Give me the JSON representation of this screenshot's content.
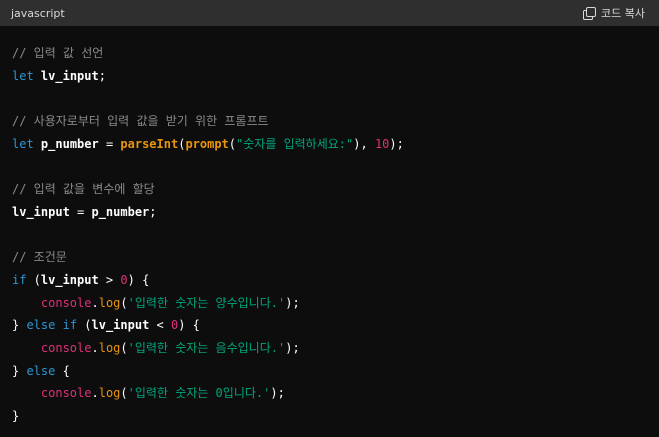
{
  "header": {
    "language": "javascript",
    "copy_label": "코드 복사",
    "copy_icon": "copy-icon"
  },
  "colors": {
    "header_bg": "#2f2f2f",
    "code_bg": "#0d0d0d",
    "comment": "#8a8a8a",
    "keyword": "#2e95d3",
    "string": "#00a67d",
    "number": "#df3079",
    "builtin": "#e9950c"
  },
  "code": {
    "lines": [
      [
        {
          "t": "c",
          "v": "// 입력 값 선언"
        }
      ],
      [
        {
          "t": "k",
          "v": "let"
        },
        {
          "t": "o",
          "v": " "
        },
        {
          "t": "i",
          "v": "lv_input"
        },
        {
          "t": "p",
          "v": ";"
        }
      ],
      [],
      [
        {
          "t": "c",
          "v": "// 사용자로부터 입력 값을 받기 위한 프롬프트"
        }
      ],
      [
        {
          "t": "k",
          "v": "let"
        },
        {
          "t": "o",
          "v": " "
        },
        {
          "t": "i",
          "v": "p_number"
        },
        {
          "t": "o",
          "v": " = "
        },
        {
          "t": "b",
          "v": "parseInt"
        },
        {
          "t": "p",
          "v": "("
        },
        {
          "t": "b",
          "v": "prompt"
        },
        {
          "t": "p",
          "v": "("
        },
        {
          "t": "s",
          "v": "\"숫자를 입력하세요:\""
        },
        {
          "t": "p",
          "v": "), "
        },
        {
          "t": "n",
          "v": "10"
        },
        {
          "t": "p",
          "v": ");"
        }
      ],
      [],
      [
        {
          "t": "c",
          "v": "// 입력 값을 변수에 할당"
        }
      ],
      [
        {
          "t": "i",
          "v": "lv_input"
        },
        {
          "t": "o",
          "v": " = "
        },
        {
          "t": "i",
          "v": "p_number"
        },
        {
          "t": "p",
          "v": ";"
        }
      ],
      [],
      [
        {
          "t": "c",
          "v": "// 조건문"
        }
      ],
      [
        {
          "t": "k",
          "v": "if"
        },
        {
          "t": "p",
          "v": " ("
        },
        {
          "t": "i",
          "v": "lv_input"
        },
        {
          "t": "o",
          "v": " > "
        },
        {
          "t": "n",
          "v": "0"
        },
        {
          "t": "p",
          "v": ") {"
        }
      ],
      [
        {
          "t": "o",
          "v": "    "
        },
        {
          "t": "cn",
          "v": "console"
        },
        {
          "t": "p",
          "v": "."
        },
        {
          "t": "m",
          "v": "log"
        },
        {
          "t": "p",
          "v": "("
        },
        {
          "t": "s",
          "v": "'입력한 숫자는 양수입니다.'"
        },
        {
          "t": "p",
          "v": ");"
        }
      ],
      [
        {
          "t": "p",
          "v": "} "
        },
        {
          "t": "k",
          "v": "else"
        },
        {
          "t": "o",
          "v": " "
        },
        {
          "t": "k",
          "v": "if"
        },
        {
          "t": "p",
          "v": " ("
        },
        {
          "t": "i",
          "v": "lv_input"
        },
        {
          "t": "o",
          "v": " < "
        },
        {
          "t": "n",
          "v": "0"
        },
        {
          "t": "p",
          "v": ") {"
        }
      ],
      [
        {
          "t": "o",
          "v": "    "
        },
        {
          "t": "cn",
          "v": "console"
        },
        {
          "t": "p",
          "v": "."
        },
        {
          "t": "m",
          "v": "log"
        },
        {
          "t": "p",
          "v": "("
        },
        {
          "t": "s",
          "v": "'입력한 숫자는 음수입니다.'"
        },
        {
          "t": "p",
          "v": ");"
        }
      ],
      [
        {
          "t": "p",
          "v": "} "
        },
        {
          "t": "k",
          "v": "else"
        },
        {
          "t": "p",
          "v": " {"
        }
      ],
      [
        {
          "t": "o",
          "v": "    "
        },
        {
          "t": "cn",
          "v": "console"
        },
        {
          "t": "p",
          "v": "."
        },
        {
          "t": "m",
          "v": "log"
        },
        {
          "t": "p",
          "v": "("
        },
        {
          "t": "s",
          "v": "'입력한 숫자는 0입니다.'"
        },
        {
          "t": "p",
          "v": ");"
        }
      ],
      [
        {
          "t": "p",
          "v": "}"
        }
      ]
    ]
  }
}
